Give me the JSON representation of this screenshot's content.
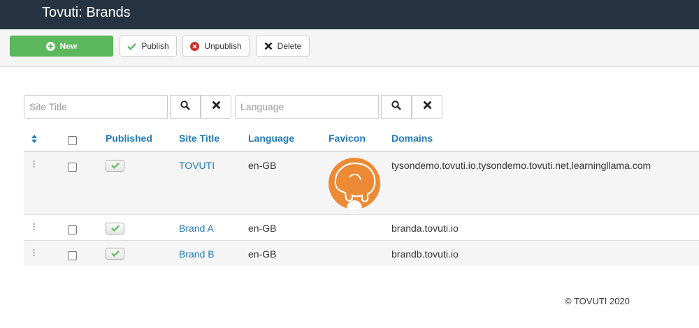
{
  "header": {
    "title": "Tovuti: Brands"
  },
  "toolbar": {
    "new_label": "New",
    "publish_label": "Publish",
    "unpublish_label": "Unpublish",
    "delete_label": "Delete"
  },
  "filters": {
    "site_title_placeholder": "Site Title",
    "language_placeholder": "Language"
  },
  "table": {
    "columns": [
      "Published",
      "Site Title",
      "Language",
      "Favicon",
      "Domains"
    ],
    "rows": [
      {
        "site_title": "TOVUTI",
        "language": "en-GB",
        "domains": "tysondemo.tovuti.io,tysondemo.tovuti.net,learningllama.com",
        "published": true,
        "has_favicon": true
      },
      {
        "site_title": "Brand A",
        "language": "en-GB",
        "domains": "branda.tovuti.io",
        "published": true,
        "has_favicon": false
      },
      {
        "site_title": "Brand B",
        "language": "en-GB",
        "domains": "brandb.tovuti.io",
        "published": true,
        "has_favicon": false
      }
    ]
  },
  "footer": {
    "copyright": "© TOVUTI 2020"
  },
  "colors": {
    "header_bg": "#253342",
    "accent_link": "#1f7ab8",
    "new_button": "#5cb85c",
    "favicon_orange": "#ec8a36",
    "unpublish_red": "#c9302c"
  }
}
